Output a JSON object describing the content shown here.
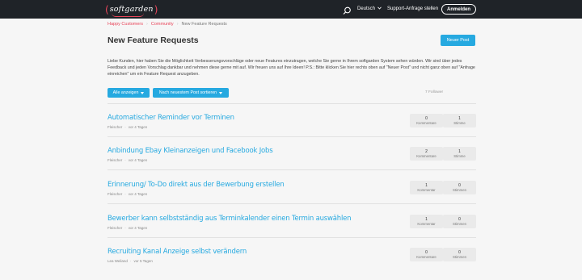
{
  "header": {
    "logo_text": "softgarden",
    "language": "Deutsch",
    "support_link": "Support-Anfrage stellen",
    "login_button": "Anmelden"
  },
  "breadcrumb": {
    "items": [
      "Happy Customers",
      "Community",
      "New Feature Requests"
    ],
    "separator": "›"
  },
  "page": {
    "title": "New Feature Requests",
    "new_post_button": "Neuer Post",
    "intro": "Liebe Kunden, hier haben Sie die Möglichkeit Verbesserungsvorschläge oder neue Features einzutragen, welche Sie gerne in Ihrem softgarden System sehen würden. Wir sind über jedes Feedback und jeden Vorschlag dankbar und nehmen diese gerne mit auf. Wir freuen uns auf Ihre Ideen! P.S.: Bitte klicken Sie hier rechts oben auf \"Neuer Post\" und nicht ganz oben auf \"Anfrage einreichen\" um ein Feature Request anzugeben.",
    "filter_show_all": "Alle anzeigen",
    "filter_sort": "Nach neuestem Post sortieren",
    "follower_count": "7 Follower"
  },
  "posts": [
    {
      "title": "Automatischer Reminder vor Terminen",
      "author": "Fleischer",
      "age": "vor 4 Tagen",
      "comments": "0",
      "comments_label": "Kommentare",
      "votes": "1",
      "votes_label": "Stimme"
    },
    {
      "title": "Anbindung Ebay Kleinanzeigen und Facebook Jobs",
      "author": "Fleischer",
      "age": "vor 4 Tagen",
      "comments": "2",
      "comments_label": "Kommentare",
      "votes": "1",
      "votes_label": "Stimme"
    },
    {
      "title": "Erinnerung/ To-Do direkt aus der Bewerbung erstellen",
      "author": "Fleischer",
      "age": "vor 4 Tagen",
      "comments": "1",
      "comments_label": "Kommentar",
      "votes": "0",
      "votes_label": "Stimmen"
    },
    {
      "title": "Bewerber kann selbstständig aus Terminkalender einen Termin auswählen",
      "author": "Fleischer",
      "age": "vor 4 Tagen",
      "comments": "1",
      "comments_label": "Kommentar",
      "votes": "0",
      "votes_label": "Stimmen"
    },
    {
      "title": "Recruiting Kanal Anzeige selbst verändern",
      "author": "Lea Weiland",
      "age": "vor 5 Tagen",
      "comments": "0",
      "comments_label": "Kommentare",
      "votes": "0",
      "votes_label": "Stimmen"
    }
  ],
  "colors": {
    "accent": "#26a9e0",
    "brand": "#e8455a",
    "header_bg": "#1f2328",
    "page_bg": "#f6f6f6"
  }
}
